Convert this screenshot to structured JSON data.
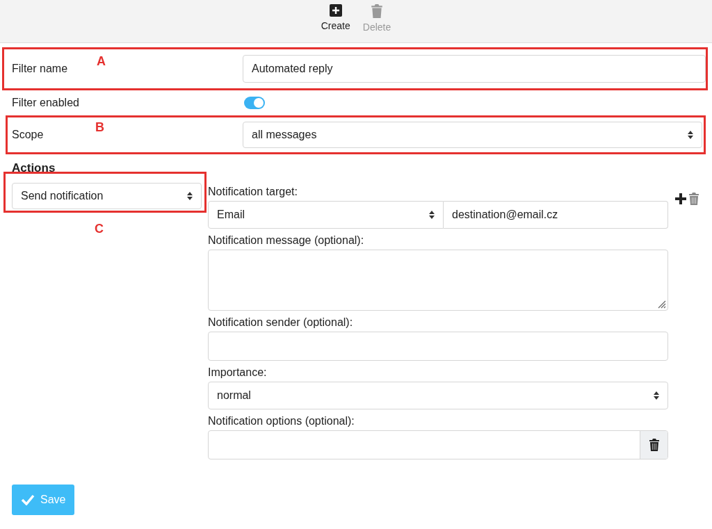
{
  "toolbar": [
    {
      "label": "Create",
      "kind": "create",
      "disabled": false
    },
    {
      "label": "Delete",
      "kind": "delete",
      "disabled": true
    }
  ],
  "filter_name": {
    "label": "Filter name",
    "value": "Automated reply",
    "callout": "A"
  },
  "filter_enabled": {
    "label": "Filter enabled",
    "on": true
  },
  "scope": {
    "label": "Scope",
    "value": "all messages",
    "callout": "B"
  },
  "actions": {
    "heading": "Actions",
    "action_select": {
      "value": "Send notification",
      "callout": "C"
    },
    "fields": [
      {
        "kind": "target",
        "label": "Notification target:",
        "select_value": "Email",
        "value": "destination@email.cz"
      },
      {
        "kind": "textarea",
        "label": "Notification message (optional):"
      },
      {
        "kind": "input",
        "label": "Notification sender (optional):"
      },
      {
        "kind": "select",
        "label": "Importance:",
        "value": "normal"
      },
      {
        "kind": "input-delete",
        "label": "Notification options (optional):"
      }
    ]
  },
  "save": {
    "label": "Save"
  }
}
